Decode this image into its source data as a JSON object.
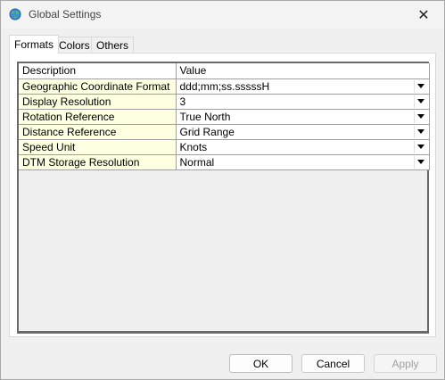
{
  "window": {
    "title": "Global Settings",
    "close_glyph": "✕"
  },
  "tabs": [
    {
      "label": "Formats",
      "active": true
    },
    {
      "label": "Colors",
      "active": false
    },
    {
      "label": "Others",
      "active": false
    }
  ],
  "grid": {
    "headers": {
      "description": "Description",
      "value": "Value"
    },
    "rows": [
      {
        "description": "Geographic Coordinate Format",
        "value": "ddd;mm;ss.sssssH"
      },
      {
        "description": "Display Resolution",
        "value": "3"
      },
      {
        "description": "Rotation Reference",
        "value": "True North"
      },
      {
        "description": "Distance Reference",
        "value": "Grid Range"
      },
      {
        "description": "Speed Unit",
        "value": "Knots"
      },
      {
        "description": "DTM Storage Resolution",
        "value": "Normal"
      }
    ]
  },
  "buttons": {
    "ok": "OK",
    "cancel": "Cancel",
    "apply": "Apply"
  },
  "icons": {
    "app": "globe-icon",
    "close": "close-icon",
    "dropdown": "dropdown-arrow-icon"
  },
  "colors": {
    "description_cell_bg": "#ffffe1",
    "grid_border": "#696969"
  }
}
